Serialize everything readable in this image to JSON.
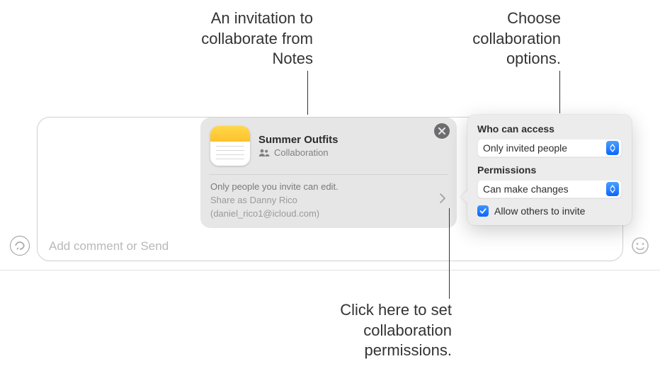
{
  "callouts": {
    "invite": "An invitation to collaborate from Notes",
    "options": "Choose collaboration options.",
    "permissions": "Click here to set collaboration permissions."
  },
  "compose": {
    "placeholder": "Add comment or Send"
  },
  "invite": {
    "title": "Summer Outfits",
    "badge": "Collaboration",
    "info": "Only people you invite can edit.",
    "share_as_label": "Share as Danny Rico",
    "share_as_email": "(daniel_rico1@icloud.com)"
  },
  "popover": {
    "access_label": "Who can access",
    "access_value": "Only invited people",
    "perm_label": "Permissions",
    "perm_value": "Can make changes",
    "allow_label": "Allow others to invite"
  }
}
